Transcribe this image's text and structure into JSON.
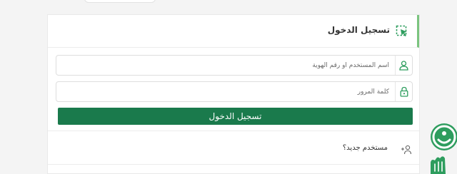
{
  "login": {
    "header_title": "تسجيل الدخول",
    "username_placeholder": "اسم المستخدم أو رقم الهوية",
    "password_placeholder": "كلمة المرور",
    "submit_label": "تسجيل الدخول",
    "new_user_text": "مستخدم جديد؟"
  },
  "colors": {
    "primary": "#1a7a4c",
    "accent": "#7bc47f",
    "icon": "#2e9d5e"
  },
  "icons": {
    "header": "cursor-select-icon",
    "username": "user-icon",
    "password": "lock-icon",
    "new_user": "user-plus-icon",
    "side_widget": "accessibility-icon"
  }
}
